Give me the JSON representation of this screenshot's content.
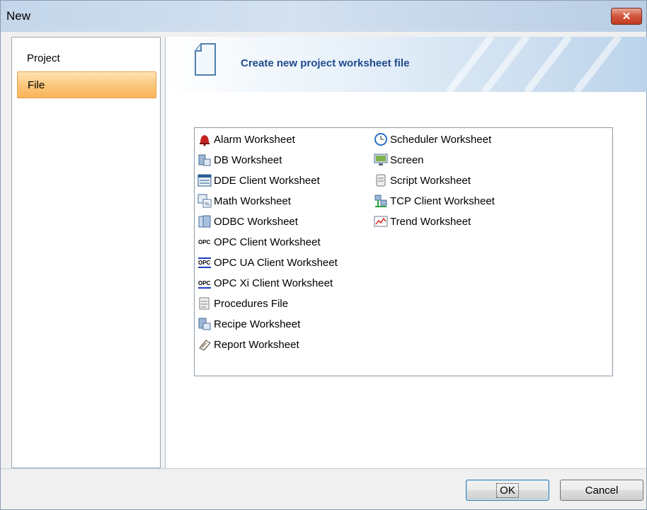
{
  "window": {
    "title": "New",
    "close_label": "✕"
  },
  "sidebar": {
    "items": [
      {
        "label": "Project",
        "selected": false
      },
      {
        "label": "File",
        "selected": true
      }
    ]
  },
  "banner": {
    "text": "Create new project worksheet file",
    "icon": "document-icon"
  },
  "file_types": {
    "column1": [
      {
        "label": "Alarm Worksheet",
        "icon": "alarm-bell-icon"
      },
      {
        "label": "DB Worksheet",
        "icon": "db-icon"
      },
      {
        "label": "DDE Client Worksheet",
        "icon": "dde-icon"
      },
      {
        "label": "Math Worksheet",
        "icon": "math-icon"
      },
      {
        "label": "ODBC Worksheet",
        "icon": "odbc-icon"
      },
      {
        "label": "OPC Client Worksheet",
        "icon": "opc-icon"
      },
      {
        "label": "OPC UA Client Worksheet",
        "icon": "opc-ua-icon"
      },
      {
        "label": "OPC Xi Client Worksheet",
        "icon": "opc-xi-icon"
      },
      {
        "label": "Procedures File",
        "icon": "procedures-icon"
      },
      {
        "label": "Recipe Worksheet",
        "icon": "recipe-icon"
      },
      {
        "label": "Report Worksheet",
        "icon": "report-icon"
      }
    ],
    "column2": [
      {
        "label": "Scheduler Worksheet",
        "icon": "scheduler-clock-icon"
      },
      {
        "label": "Screen",
        "icon": "screen-icon"
      },
      {
        "label": "Script Worksheet",
        "icon": "script-icon"
      },
      {
        "label": "TCP Client Worksheet",
        "icon": "tcp-icon"
      },
      {
        "label": "Trend Worksheet",
        "icon": "trend-icon"
      }
    ]
  },
  "buttons": {
    "ok": "OK",
    "cancel": "Cancel"
  },
  "colors": {
    "selection": "#f9b45a",
    "banner_text": "#1f4a8c",
    "close": "#c23b22"
  }
}
